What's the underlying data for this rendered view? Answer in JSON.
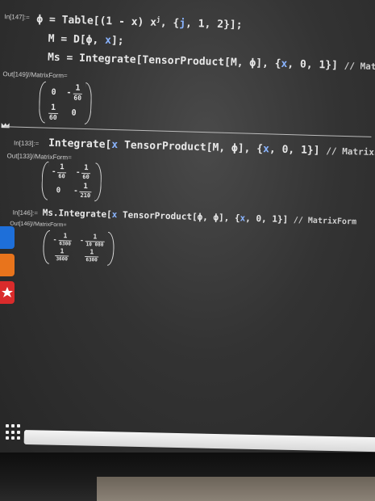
{
  "cells": [
    {
      "label": "In[147]:=",
      "lines": [
        "ϕ = Table[(1 - x) xʲ, {j, 1, 2}];",
        "M = D[ϕ, x];",
        "Ms = Integrate[TensorProduct[M, ϕ], {x, 0, 1}] // MatrixForm"
      ]
    },
    {
      "label": "Out[149]//MatrixForm=",
      "matrix": [
        [
          "0",
          "-",
          "1",
          "60"
        ],
        [
          "",
          "1",
          "60",
          "0"
        ]
      ]
    },
    {
      "label": "In[133]:=",
      "lines": [
        "Integrate[x TensorProduct[M, ϕ], {x, 0, 1}] // MatrixForm"
      ]
    },
    {
      "label": "Out[133]//MatrixForm="
    },
    {
      "label": "In[146]:=",
      "lines": [
        "Ms.Integrate[x TensorProduct[ϕ, ϕ], {x, 0, 1}] // MatrixForm"
      ]
    },
    {
      "label": "Out[146]//MatrixForm="
    }
  ],
  "out149": {
    "r1c1": "0",
    "r1c2_num": "1",
    "r1c2_den": "60",
    "r2c1_num": "1",
    "r2c1_den": "60",
    "r2c2": "0"
  },
  "out133": {
    "r1c1_num": "1",
    "r1c1_den": "60",
    "r1c2_num": "1",
    "r1c2_den": "60",
    "r2c1": "0",
    "r2c2_num": "1",
    "r2c2_den": "210"
  },
  "out146": {
    "r1c1_num": "1",
    "r1c1_den": "6300",
    "r1c2_num": "1",
    "r1c2_den": "10 080",
    "r2c1_num": "1",
    "r2c1_den": "3600",
    "r2c2_num": "1",
    "r2c2_den": "6300"
  },
  "code": {
    "in147_l1_a": "ϕ = Table[(1 - x) x",
    "in147_l1_sup": "j",
    "in147_l1_b": ", {",
    "in147_l1_j": "j",
    "in147_l1_c": ", 1, 2}];",
    "in147_l2_a": "M = D[ϕ, ",
    "in147_l2_x": "x",
    "in147_l2_b": "];",
    "in147_l3": "Ms = Integrate[TensorProduct[M, ϕ], {",
    "in147_l3_x": "x",
    "in147_l3_b": ", 0, 1}] ",
    "in147_l3_c": "// MatrixForm",
    "in133_a": "Integrate[",
    "in133_x": "x",
    "in133_b": " TensorProduct[M, ϕ], {",
    "in133_x2": "x",
    "in133_c": ", 0, 1}] ",
    "in133_d": "// MatrixForm",
    "in146_a": "Ms.Integrate[",
    "in146_x": "x",
    "in146_b": " TensorProduct[ϕ, ϕ], {",
    "in146_x2": "x",
    "in146_c": ", 0, 1}] ",
    "in146_d": "// MatrixForm"
  },
  "labels": {
    "in147": "In[147]:=",
    "out149": "Out[149]//MatrixForm=",
    "in133": "In[133]:=",
    "out133": "Out[133]//MatrixForm=",
    "in146": "In[146]:=",
    "out146": "Out[146]//MatrixForm="
  },
  "minus": "-",
  "colors": {
    "symbol": "#8ab4ff",
    "text": "#e8e8e8",
    "taskbar": "#eeeeee"
  }
}
